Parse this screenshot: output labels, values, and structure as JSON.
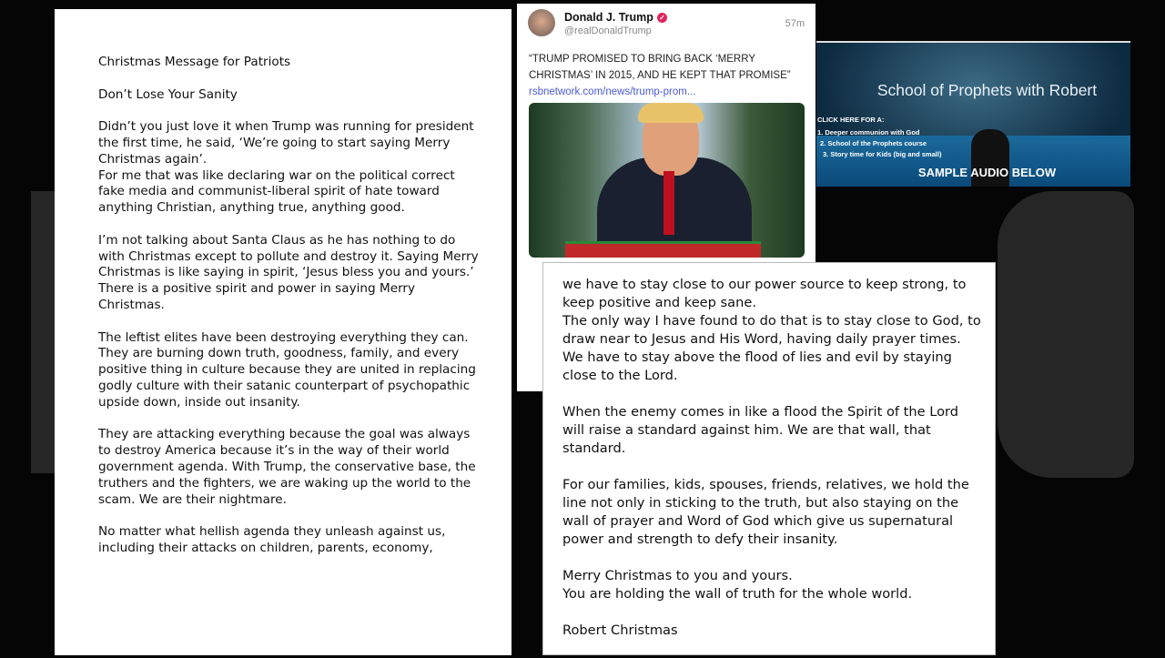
{
  "left_document": {
    "paragraphs": [
      "Christmas Message for Patriots",
      "Don’t Lose Your Sanity",
      "Didn’t you just love it when Trump was running for president the first time, he said, ‘We’re going to start saying Merry Christmas again’.\nFor me that was like declaring war on the political correct fake media and communist-liberal spirit of hate toward anything Christian, anything true, anything good.",
      "I’m not talking about Santa Claus as he has nothing to do with Christmas except to pollute and destroy it. Saying Merry Christmas is like saying in spirit, ‘Jesus bless you and yours.’  There is a positive spirit and power in saying Merry Christmas.",
      "The leftist elites have been destroying everything they can. They are burning down truth, goodness, family, and every positive thing in culture because they are united in replacing godly culture with their satanic counterpart of psychopathic upside down, inside out insanity.",
      "They are attacking everything because the goal was always to destroy America because it’s in the way of their world government agenda.  With Trump, the conservative base, the truthers and the fighters, we are waking up the world to the scam.  We are their nightmare.",
      "No matter what hellish agenda they unleash against us, including their attacks on children, parents, economy,"
    ]
  },
  "tweet": {
    "name": "Donald J. Trump",
    "handle": "@realDonaldTrump",
    "time": "57m",
    "text": "“TRUMP PROMISED TO BRING BACK ‘MERRY CHRISTMAS’ IN 2015, AND HE KEPT THAT PROMISE” ",
    "link": "rsbnetwork.com/news/trump-prom...",
    "verified_color": "#e0245e"
  },
  "ad": {
    "title": "School of Prophets with Robert",
    "click": "CLICK HERE FOR A:",
    "items": [
      "1. Deeper communion with God",
      "2. School of the Prophets course",
      "3. Story time for Kids (big and small)"
    ],
    "sample": "SAMPLE AUDIO BELOW"
  },
  "right_document": {
    "paragraphs": [
      "we have to stay close to our power source to keep strong, to keep positive and keep sane.\nThe only way I have found to do that is to stay close to God, to draw near to Jesus and His Word, having daily prayer times.  We have to stay above the flood of lies and evil by staying close to the Lord.",
      "When the enemy comes in like a flood the Spirit of the Lord will raise a standard against him.  We are that wall, that standard.",
      "For our families, kids, spouses, friends, relatives, we hold the line not only in sticking to the truth, but also staying on the wall of prayer and Word of God which give us supernatural power and strength to defy their insanity.",
      "Merry Christmas to you and yours.\nYou are holding the wall of truth for the whole world.",
      "Robert Christmas"
    ]
  }
}
